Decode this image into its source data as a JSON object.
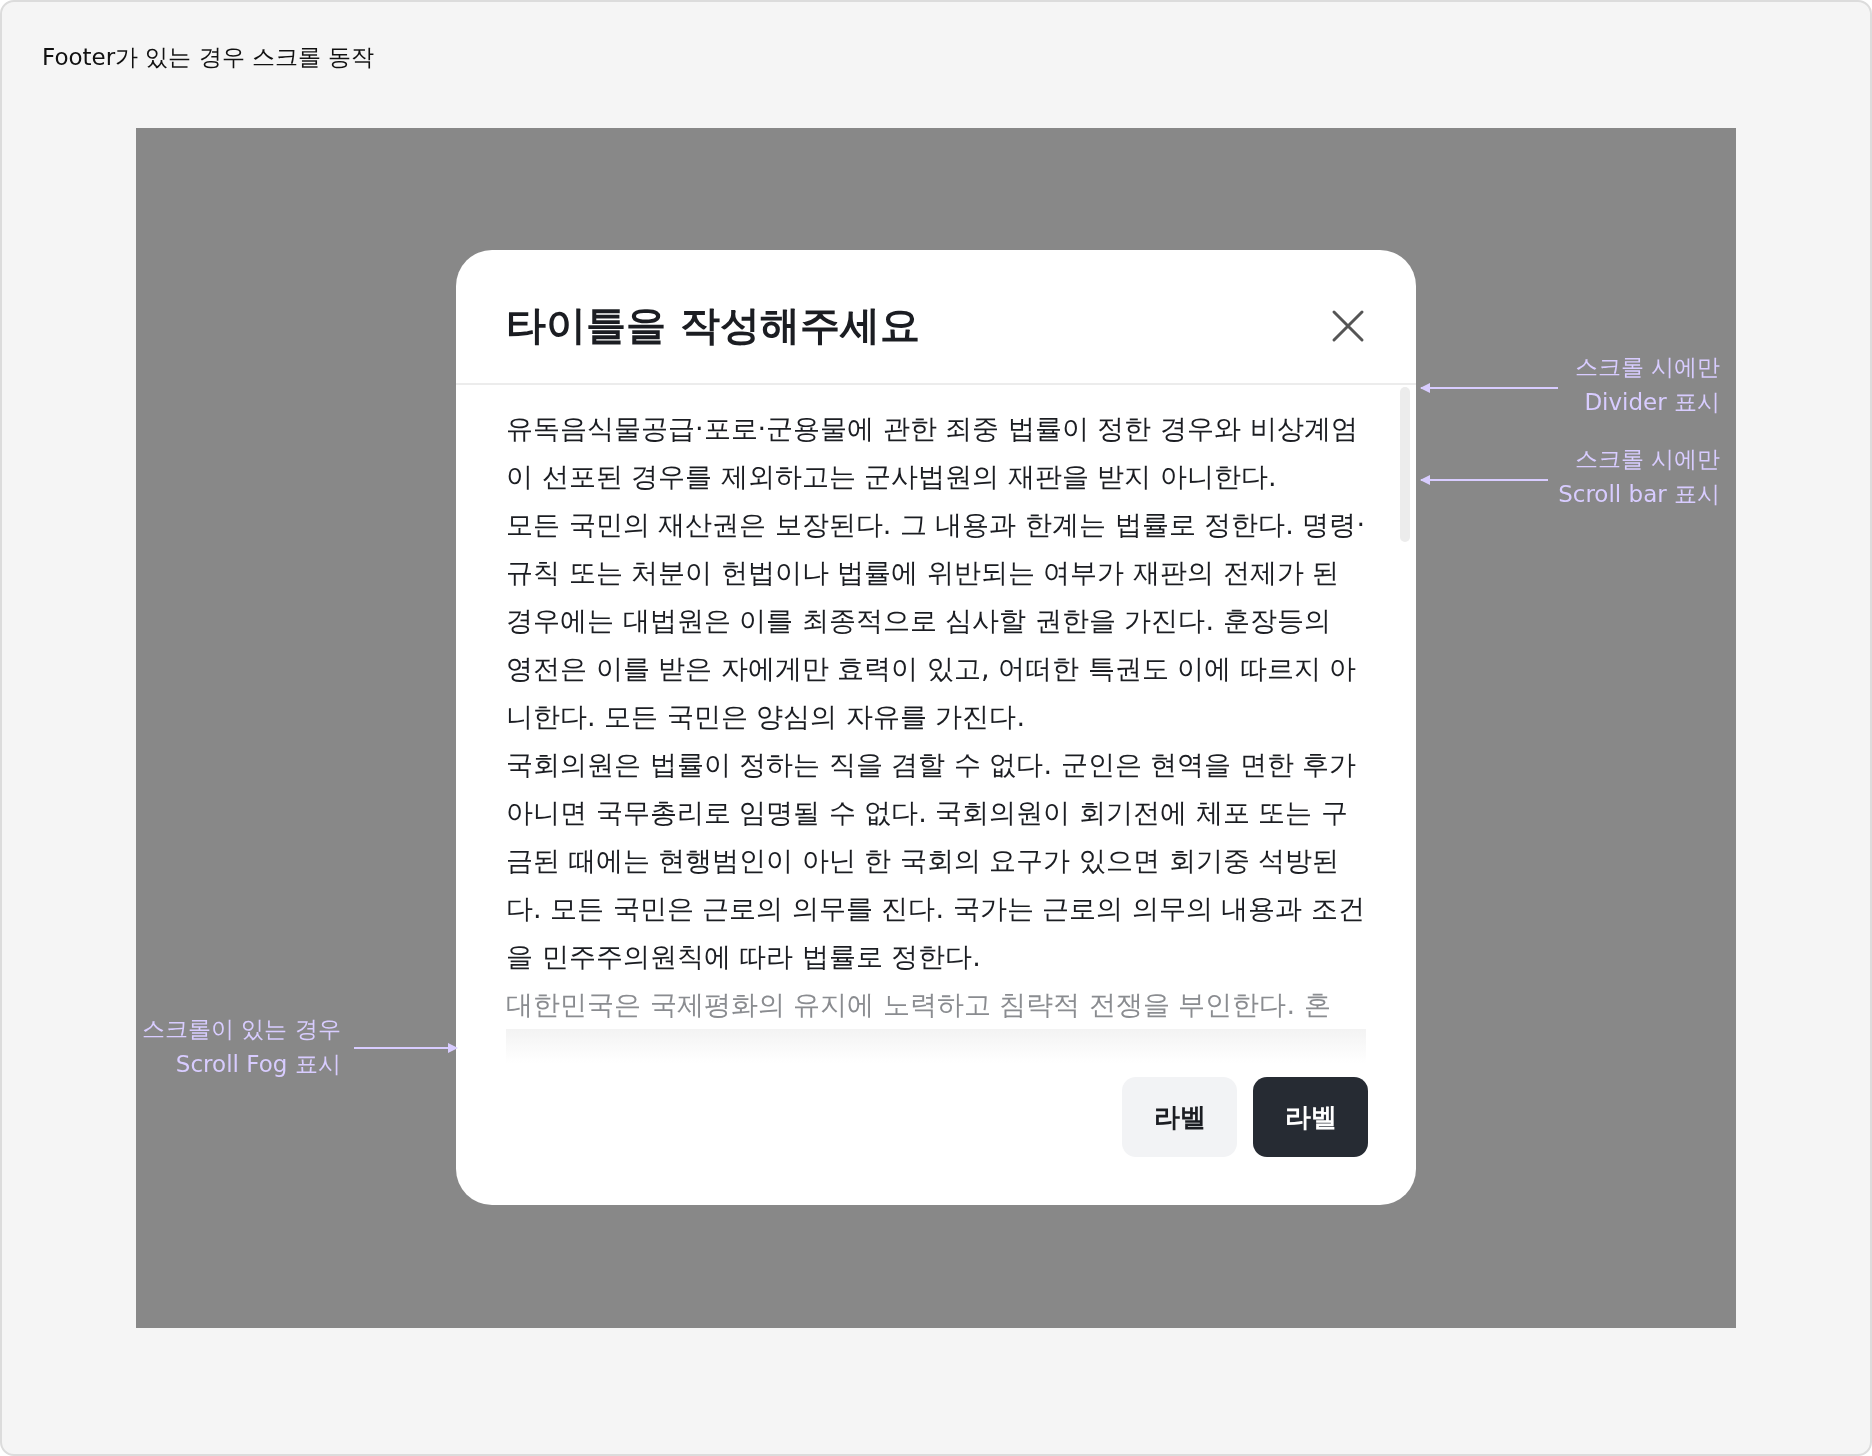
{
  "page_title": "Footer가 있는 경우 스크롤 동작",
  "dialog": {
    "title": "타이틀을 작성해주세요",
    "scrolled": true,
    "fog": true,
    "paragraphs": [
      {
        "kind": "normal",
        "text": "유독음식물공급·포로·군용물에 관한 죄중 법률이 정한 경우와 비상계엄이 선포된 경우를 제외하고는 군사법원의 재판을 받지 아니한다."
      },
      {
        "kind": "normal",
        "text": "모든 국민의 재산권은 보장된다. 그 내용과 한계는 법률로 정한다. 명령·규칙 또는 처분이 헌법이나 법률에 위반되는 여부가 재판의 전제가 된 경우에는 대법원은 이를 최종적으로 심사할 권한을 가진다. 훈장등의 영전은 이를 받은 자에게만 효력이 있고, 어떠한 특권도 이에 따르지 아니한다. 모든 국민은 양심의 자유를 가진다."
      },
      {
        "kind": "normal",
        "text": "국회의원은 법률이 정하는 직을 겸할 수 없다. 군인은 현역을 면한 후가 아니면 국무총리로 임명될 수 없다. 국회의원이 회기전에 체포 또는 구금된 때에는 현행범인이 아닌 한 국회의 요구가 있으면 회기중 석방된다. 모든 국민은 근로의 의무를 진다. 국가는 근로의 의무의 내용과 조건을 민주주의원칙에 따라 법률로 정한다."
      },
      {
        "kind": "faded",
        "text": "대한민국은 국제평화의 유지에 노력하고 침략적 전쟁을 부인한다. 혼"
      }
    ],
    "buttons": [
      {
        "kind": "secondary",
        "label": "라벨"
      },
      {
        "kind": "primary",
        "label": "라벨"
      }
    ]
  },
  "annotations": [
    {
      "kind": "divider",
      "lines": [
        "스크롤 시에만",
        "Divider 표시"
      ]
    },
    {
      "kind": "scrollbar",
      "lines": [
        "스크롤 시에만",
        "Scroll bar 표시"
      ]
    },
    {
      "kind": "fog",
      "lines": [
        "스크롤이 있는 경우",
        "Scroll Fog 표시"
      ]
    }
  ]
}
